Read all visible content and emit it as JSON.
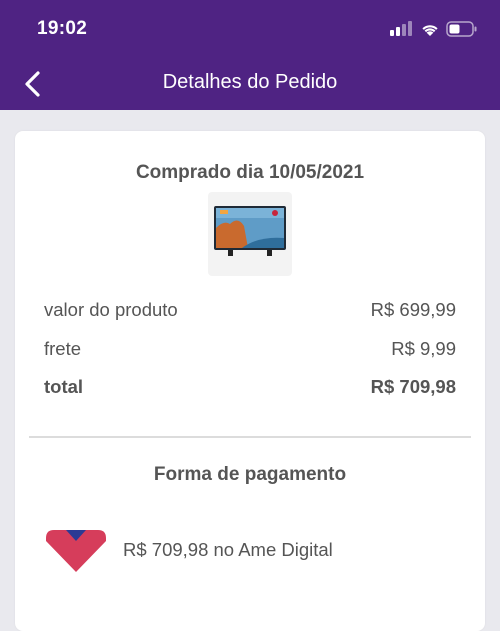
{
  "status_bar": {
    "time": "19:02"
  },
  "nav": {
    "title": "Detalhes do Pedido"
  },
  "order": {
    "purchase_date": "Comprado dia 10/05/2021",
    "product_label": "valor do produto",
    "product_value": "R$ 699,99",
    "shipping_label": "frete",
    "shipping_value": "R$ 9,99",
    "total_label": "total",
    "total_value": "R$ 709,98"
  },
  "payment": {
    "heading": "Forma de pagamento",
    "description": "R$ 709,98 no Ame Digital"
  },
  "icons": {
    "back": "chevron-left-icon",
    "signal": "cellular-signal-icon",
    "wifi": "wifi-icon",
    "battery": "battery-icon",
    "ame": "ame-digital-logo-icon"
  },
  "colors": {
    "header": "#4f2383",
    "background": "#e9e9ee",
    "card": "#ffffff",
    "text": "#555555",
    "ame_red": "#d63d5b",
    "ame_blue": "#2c3a94"
  }
}
